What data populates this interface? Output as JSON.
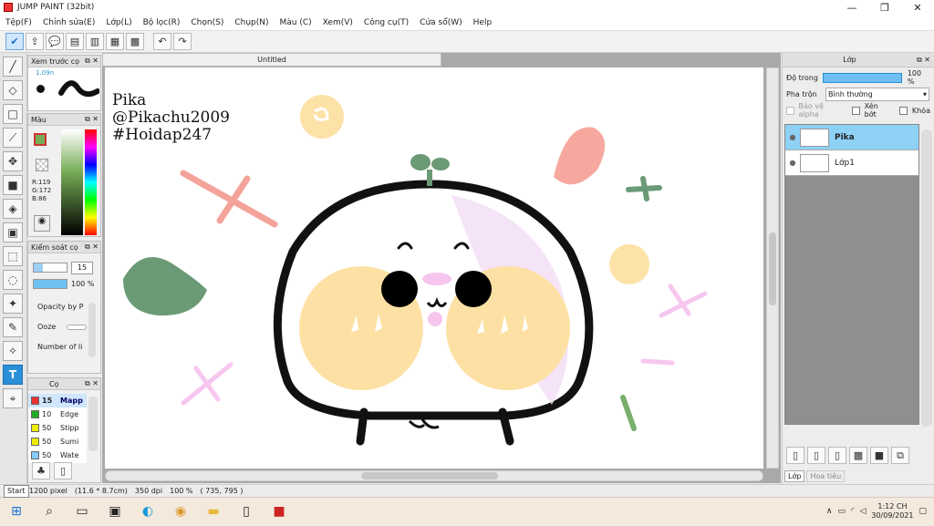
{
  "window": {
    "title": "JUMP PAINT (32bit)"
  },
  "menu": [
    "Tệp(F)",
    "Chỉnh sửa(E)",
    "Lớp(L)",
    "Bộ lọc(R)",
    "Chọn(S)",
    "Chụp(N)",
    "Màu (C)",
    "Xem(V)",
    "Công cụ(T)",
    "Cửa sổ(W)",
    "Help"
  ],
  "panels": {
    "preview": {
      "title": "Xem trước cọ",
      "zoom": "1.09n"
    },
    "color": {
      "title": "Màu",
      "r": "R:119",
      "g": "G:172",
      "b": "B:86",
      "swatch": "#77ac56"
    },
    "brush_control": {
      "title": "Kiểm soát cọ",
      "size": "15",
      "opacity_pct": "100 %",
      "labels": [
        "Opacity by P",
        "Ooze",
        "Number of li"
      ]
    },
    "brushes": {
      "title": "Cọ",
      "items": [
        {
          "size": "15",
          "name": "Mapp",
          "color": "#e33"
        },
        {
          "size": "10",
          "name": "Edge",
          "color": "#2a2"
        },
        {
          "size": "50",
          "name": "Stipp",
          "color": "#ee0"
        },
        {
          "size": "50",
          "name": "Sumi",
          "color": "#ee0"
        },
        {
          "size": "50",
          "name": "Wate",
          "color": "#8cf"
        }
      ]
    }
  },
  "document": {
    "tab": "Untitled",
    "watermark": [
      "Pika",
      "@Pikachu2009",
      "#Hoidap247"
    ]
  },
  "layers_panel": {
    "title": "Lớp",
    "opacity_label": "Độ trong",
    "opacity_value": "100 %",
    "blend_label": "Pha trộn",
    "blend_value": "Bình thường",
    "options": [
      "Bảo vệ alpha",
      "Xén bớt",
      "Khóa"
    ],
    "layers": [
      {
        "name": "Pika",
        "selected": true
      },
      {
        "name": "Lớp1",
        "selected": false
      }
    ],
    "tabs": [
      "Lớp",
      "Hoa tiêu"
    ]
  },
  "status": {
    "size": "1200 pixel",
    "cm": "(11.6 * 8.7cm)",
    "dpi": "350 dpi",
    "zoom": "100 %",
    "coords": "( 735, 795 )"
  },
  "taskbar": {
    "start_tip": "Start",
    "time": "1:12 CH",
    "date": "30/09/2021"
  }
}
